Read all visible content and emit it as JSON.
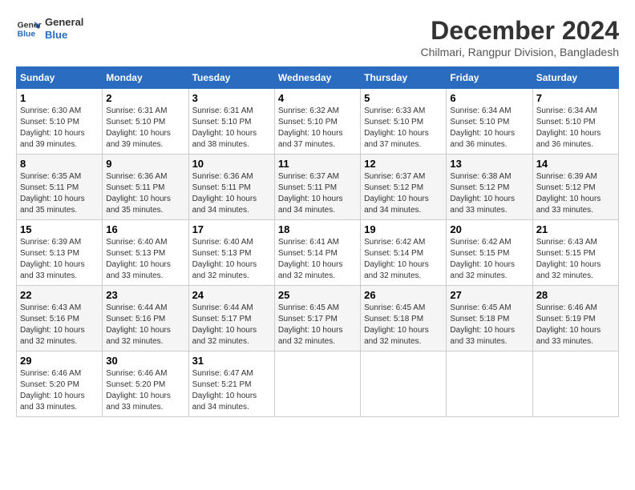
{
  "logo": {
    "line1": "General",
    "line2": "Blue"
  },
  "title": "December 2024",
  "location": "Chilmari, Rangpur Division, Bangladesh",
  "columns": [
    "Sunday",
    "Monday",
    "Tuesday",
    "Wednesday",
    "Thursday",
    "Friday",
    "Saturday"
  ],
  "weeks": [
    [
      {
        "day": "1",
        "info": "Sunrise: 6:30 AM\nSunset: 5:10 PM\nDaylight: 10 hours\nand 39 minutes."
      },
      {
        "day": "2",
        "info": "Sunrise: 6:31 AM\nSunset: 5:10 PM\nDaylight: 10 hours\nand 39 minutes."
      },
      {
        "day": "3",
        "info": "Sunrise: 6:31 AM\nSunset: 5:10 PM\nDaylight: 10 hours\nand 38 minutes."
      },
      {
        "day": "4",
        "info": "Sunrise: 6:32 AM\nSunset: 5:10 PM\nDaylight: 10 hours\nand 37 minutes."
      },
      {
        "day": "5",
        "info": "Sunrise: 6:33 AM\nSunset: 5:10 PM\nDaylight: 10 hours\nand 37 minutes."
      },
      {
        "day": "6",
        "info": "Sunrise: 6:34 AM\nSunset: 5:10 PM\nDaylight: 10 hours\nand 36 minutes."
      },
      {
        "day": "7",
        "info": "Sunrise: 6:34 AM\nSunset: 5:10 PM\nDaylight: 10 hours\nand 36 minutes."
      }
    ],
    [
      {
        "day": "8",
        "info": "Sunrise: 6:35 AM\nSunset: 5:11 PM\nDaylight: 10 hours\nand 35 minutes."
      },
      {
        "day": "9",
        "info": "Sunrise: 6:36 AM\nSunset: 5:11 PM\nDaylight: 10 hours\nand 35 minutes."
      },
      {
        "day": "10",
        "info": "Sunrise: 6:36 AM\nSunset: 5:11 PM\nDaylight: 10 hours\nand 34 minutes."
      },
      {
        "day": "11",
        "info": "Sunrise: 6:37 AM\nSunset: 5:11 PM\nDaylight: 10 hours\nand 34 minutes."
      },
      {
        "day": "12",
        "info": "Sunrise: 6:37 AM\nSunset: 5:12 PM\nDaylight: 10 hours\nand 34 minutes."
      },
      {
        "day": "13",
        "info": "Sunrise: 6:38 AM\nSunset: 5:12 PM\nDaylight: 10 hours\nand 33 minutes."
      },
      {
        "day": "14",
        "info": "Sunrise: 6:39 AM\nSunset: 5:12 PM\nDaylight: 10 hours\nand 33 minutes."
      }
    ],
    [
      {
        "day": "15",
        "info": "Sunrise: 6:39 AM\nSunset: 5:13 PM\nDaylight: 10 hours\nand 33 minutes."
      },
      {
        "day": "16",
        "info": "Sunrise: 6:40 AM\nSunset: 5:13 PM\nDaylight: 10 hours\nand 33 minutes."
      },
      {
        "day": "17",
        "info": "Sunrise: 6:40 AM\nSunset: 5:13 PM\nDaylight: 10 hours\nand 32 minutes."
      },
      {
        "day": "18",
        "info": "Sunrise: 6:41 AM\nSunset: 5:14 PM\nDaylight: 10 hours\nand 32 minutes."
      },
      {
        "day": "19",
        "info": "Sunrise: 6:42 AM\nSunset: 5:14 PM\nDaylight: 10 hours\nand 32 minutes."
      },
      {
        "day": "20",
        "info": "Sunrise: 6:42 AM\nSunset: 5:15 PM\nDaylight: 10 hours\nand 32 minutes."
      },
      {
        "day": "21",
        "info": "Sunrise: 6:43 AM\nSunset: 5:15 PM\nDaylight: 10 hours\nand 32 minutes."
      }
    ],
    [
      {
        "day": "22",
        "info": "Sunrise: 6:43 AM\nSunset: 5:16 PM\nDaylight: 10 hours\nand 32 minutes."
      },
      {
        "day": "23",
        "info": "Sunrise: 6:44 AM\nSunset: 5:16 PM\nDaylight: 10 hours\nand 32 minutes."
      },
      {
        "day": "24",
        "info": "Sunrise: 6:44 AM\nSunset: 5:17 PM\nDaylight: 10 hours\nand 32 minutes."
      },
      {
        "day": "25",
        "info": "Sunrise: 6:45 AM\nSunset: 5:17 PM\nDaylight: 10 hours\nand 32 minutes."
      },
      {
        "day": "26",
        "info": "Sunrise: 6:45 AM\nSunset: 5:18 PM\nDaylight: 10 hours\nand 32 minutes."
      },
      {
        "day": "27",
        "info": "Sunrise: 6:45 AM\nSunset: 5:18 PM\nDaylight: 10 hours\nand 33 minutes."
      },
      {
        "day": "28",
        "info": "Sunrise: 6:46 AM\nSunset: 5:19 PM\nDaylight: 10 hours\nand 33 minutes."
      }
    ],
    [
      {
        "day": "29",
        "info": "Sunrise: 6:46 AM\nSunset: 5:20 PM\nDaylight: 10 hours\nand 33 minutes."
      },
      {
        "day": "30",
        "info": "Sunrise: 6:46 AM\nSunset: 5:20 PM\nDaylight: 10 hours\nand 33 minutes."
      },
      {
        "day": "31",
        "info": "Sunrise: 6:47 AM\nSunset: 5:21 PM\nDaylight: 10 hours\nand 34 minutes."
      },
      {
        "day": "",
        "info": ""
      },
      {
        "day": "",
        "info": ""
      },
      {
        "day": "",
        "info": ""
      },
      {
        "day": "",
        "info": ""
      }
    ]
  ]
}
